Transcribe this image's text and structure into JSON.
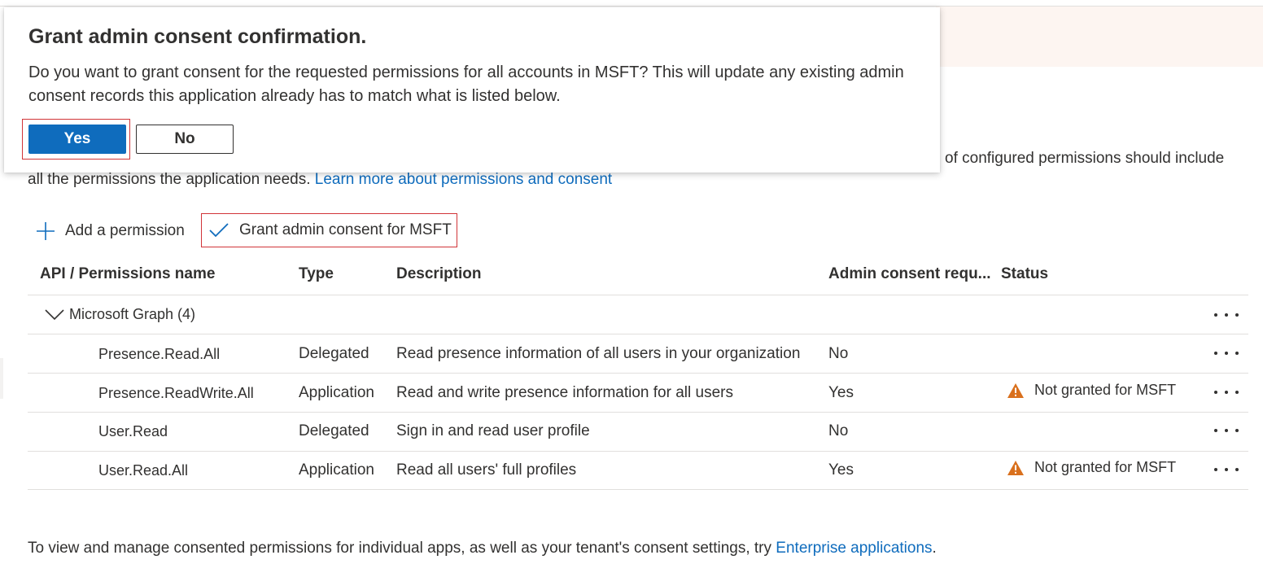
{
  "dialog": {
    "title": "Grant admin consent confirmation.",
    "message": "Do you want to grant consent for the requested permissions for all accounts in MSFT? This will update any existing admin consent records this application already has to match what is listed below.",
    "yes_label": "Yes",
    "no_label": "No"
  },
  "intro": {
    "text_right": "of configured permissions should include",
    "text_left": "all the permissions the application needs.",
    "link": "Learn more about permissions and consent"
  },
  "toolbar": {
    "add_label": "Add a permission",
    "grant_label": "Grant admin consent for MSFT"
  },
  "table": {
    "headers": [
      "API / Permissions name",
      "Type",
      "Description",
      "Admin consent requ...",
      "Status"
    ],
    "group": {
      "label": "Microsoft Graph (4)"
    },
    "rows": [
      {
        "name": "Presence.Read.All",
        "type": "Delegated",
        "description": "Read presence information of all users in your organization",
        "admin_consent": "No",
        "status": ""
      },
      {
        "name": "Presence.ReadWrite.All",
        "type": "Application",
        "description": "Read and write presence information for all users",
        "admin_consent": "Yes",
        "status": "Not granted for MSFT"
      },
      {
        "name": "User.Read",
        "type": "Delegated",
        "description": "Sign in and read user profile",
        "admin_consent": "No",
        "status": ""
      },
      {
        "name": "User.Read.All",
        "type": "Application",
        "description": "Read all users' full profiles",
        "admin_consent": "Yes",
        "status": "Not granted for MSFT"
      }
    ]
  },
  "footer": {
    "text": "To view and manage consented permissions for individual apps, as well as your tenant's consent settings, try",
    "link": "Enterprise applications",
    "end": "."
  },
  "colors": {
    "accent": "#0f6cbd",
    "highlight_border": "#d13438",
    "warning": "#d9701d"
  },
  "icons": {
    "add": "plus-icon",
    "grant": "checkmark-icon",
    "expand": "chevron-down-icon",
    "warning": "warning-icon",
    "more": "more-options-icon"
  }
}
